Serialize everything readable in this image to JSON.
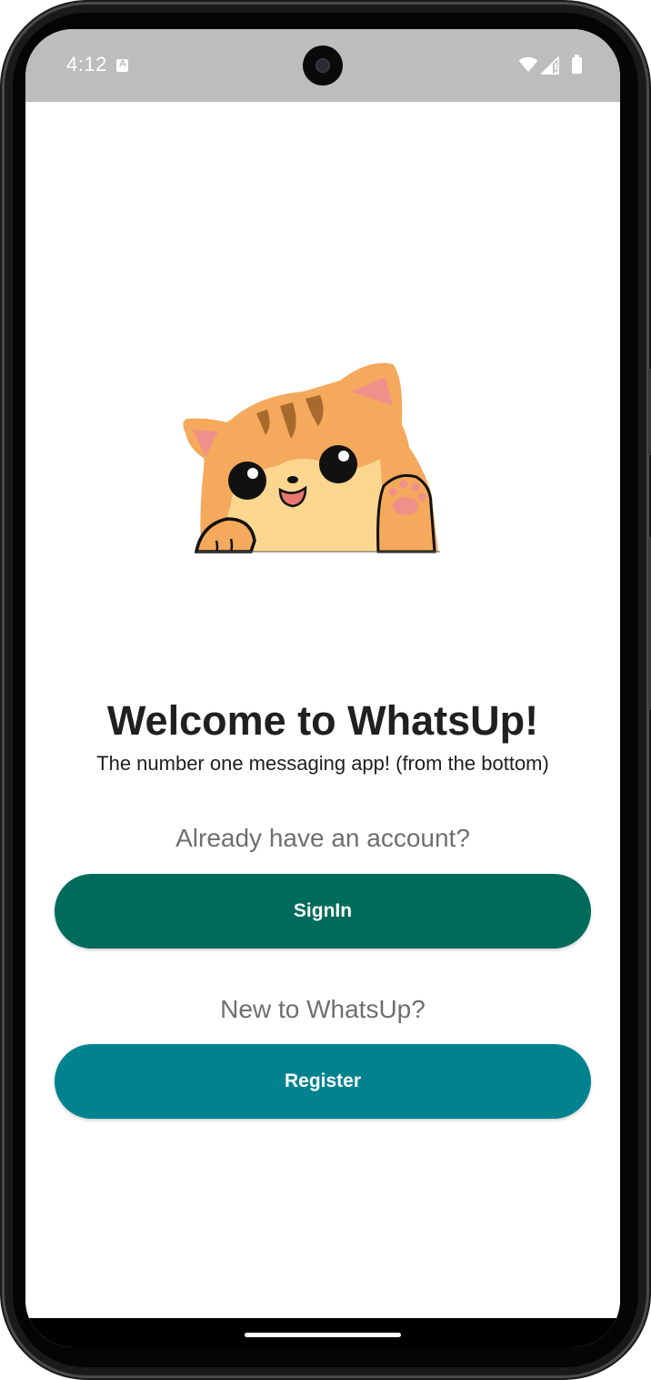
{
  "status_bar": {
    "time": "4:12",
    "notification_icon": "a-icon",
    "icons": [
      "wifi-icon",
      "signal-icon",
      "battery-icon"
    ]
  },
  "illustration": {
    "icon": "waving-cat-illustration",
    "colors": {
      "fur": "#f5a95c",
      "belly": "#fbd68f",
      "ear_inner": "#f0908a",
      "stripes": "#a86a2c",
      "outline": "#111111"
    }
  },
  "welcome": {
    "title": "Welcome to WhatsUp!",
    "subtitle": "The number one messaging app! (from the bottom)"
  },
  "signin": {
    "prompt": "Already have an account?",
    "button_label": "SignIn",
    "color": "#006b5b"
  },
  "register": {
    "prompt": "New to WhatsUp?",
    "button_label": "Register",
    "color": "#00838f"
  },
  "theme": {
    "status_bar_bg": "#bdbdbd",
    "background": "#ffffff",
    "text_primary": "#202020",
    "text_secondary": "#6f6f6f"
  }
}
